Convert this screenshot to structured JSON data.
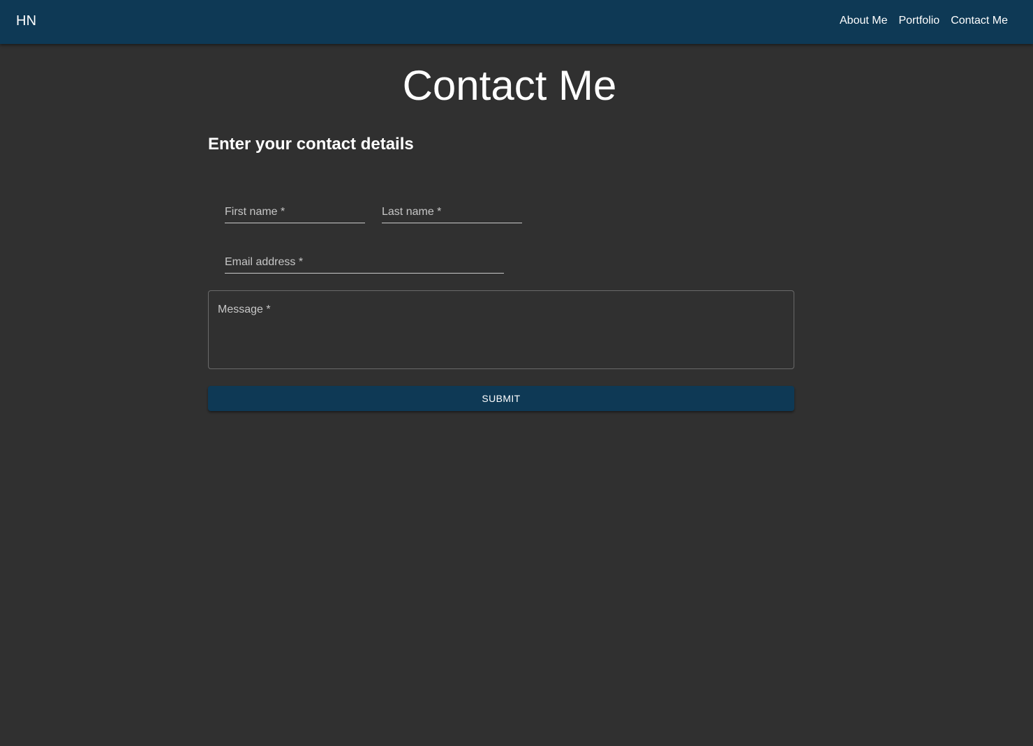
{
  "header": {
    "brand": "HN",
    "nav": [
      {
        "label": "About Me"
      },
      {
        "label": "Portfolio"
      },
      {
        "label": "Contact Me"
      }
    ]
  },
  "main": {
    "title": "Contact Me",
    "subtitle": "Enter your contact details",
    "form": {
      "first_name_label": "First name *",
      "last_name_label": "Last name *",
      "email_label": "Email address *",
      "message_label": "Message *",
      "submit_label": "SUBMIT"
    }
  },
  "colors": {
    "appbar": "#0e3955",
    "background": "#303030",
    "text": "#ffffff"
  }
}
